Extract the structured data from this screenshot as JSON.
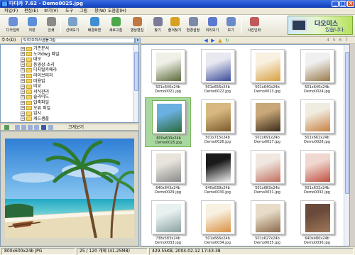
{
  "window": {
    "title": "다다카 7.62 - Demo0025.jpg"
  },
  "menu": [
    "파일(F)",
    "편집(E)",
    "보기(V)",
    "도구",
    "그림",
    "창(W)",
    "도움말(H)"
  ],
  "toolbar": [
    {
      "label": "디카입력",
      "icon": "camera-input-icon",
      "color": "#6a8fd6"
    },
    {
      "label": "저장",
      "icon": "save-icon",
      "color": "#5b8fd8"
    },
    {
      "label": "인쇄",
      "icon": "print-icon",
      "color": "#8a8a8a"
    },
    {
      "label": "선택보기",
      "icon": "select-view-icon",
      "color": "#7aa0c8"
    },
    {
      "label": "배경화면",
      "icon": "wallpaper-icon",
      "color": "#3f8fd0"
    },
    {
      "label": "새로고침",
      "icon": "refresh-icon",
      "color": "#4aa84a"
    },
    {
      "label": "영상편집",
      "icon": "image-edit-icon",
      "color": "#c07840"
    },
    {
      "label": "찾기",
      "icon": "find-icon",
      "color": "#7a7a9a"
    },
    {
      "label": "즐겨찾기",
      "icon": "favorites-icon",
      "color": "#d8a020"
    },
    {
      "label": "환경설정",
      "icon": "settings-icon",
      "color": "#7a8aa8"
    },
    {
      "label": "미리보기",
      "icon": "preview-icon",
      "color": "#5a7ad0"
    },
    {
      "label": "보기",
      "icon": "view-icon",
      "color": "#6a8ac8"
    },
    {
      "label": "사진인화",
      "icon": "photo-print-icon",
      "color": "#c05a5a"
    }
  ],
  "banner": {
    "line1": "다오미스",
    "line2": "있습니다."
  },
  "address": {
    "label": "주소(D)",
    "value": "S:\\다오미스\\샘플그림"
  },
  "page_numbers": "4 5 6 7",
  "folders": [
    {
      "name": "기존문서",
      "expanded": false
    },
    {
      "name": "노아dwg 파일",
      "expanded": false
    },
    {
      "name": "대오",
      "expanded": false
    },
    {
      "name": "동영상-소리",
      "expanded": false
    },
    {
      "name": "디지털카메라",
      "expanded": false
    },
    {
      "name": "라이브러리",
      "expanded": false
    },
    {
      "name": "미용업",
      "expanded": false
    },
    {
      "name": "비교",
      "expanded": false
    },
    {
      "name": "서식관리",
      "expanded": false
    },
    {
      "name": "솔라이드",
      "expanded": false
    },
    {
      "name": "압축파일",
      "expanded": false
    },
    {
      "name": "오류 파일",
      "expanded": false
    },
    {
      "name": "임시",
      "expanded": false
    },
    {
      "name": "캐드샘플",
      "expanded": false
    }
  ],
  "preview": {
    "title": "크게보기"
  },
  "thumbnails": [
    {
      "size": "501x640x24b",
      "name": "Demo0021.jpg",
      "selected": false,
      "colors": [
        "#f0f0e8",
        "#5a6a3a"
      ]
    },
    {
      "size": "501x656x24b",
      "name": "Demo0022.jpg",
      "selected": false,
      "colors": [
        "#e8e8f0",
        "#3a4a9a"
      ]
    },
    {
      "size": "501x640x24b",
      "name": "Demo0023.jpg",
      "selected": false,
      "colors": [
        "#f8f0e0",
        "#d8a040"
      ]
    },
    {
      "size": "501x640x24b",
      "name": "Demo0024.jpg",
      "selected": false,
      "colors": [
        "#f0f0f0",
        "#9a7a4a"
      ]
    },
    {
      "size": "800x600x24b",
      "name": "Demo0025.jpg",
      "selected": true,
      "colors": [
        "#6ab0e0",
        "#2a6a3a"
      ]
    },
    {
      "size": "501x715x24b",
      "name": "Demo0026.jpg",
      "selected": false,
      "colors": [
        "#d8b880",
        "#7a5a2a"
      ]
    },
    {
      "size": "501x691x24b",
      "name": "Demo0027.jpg",
      "selected": false,
      "colors": [
        "#c8a878",
        "#3a2a1a"
      ]
    },
    {
      "size": "501x662x24b",
      "name": "Demo0028.jpg",
      "selected": false,
      "colors": [
        "#f0ece0",
        "#c88040"
      ]
    },
    {
      "size": "640x643x24b",
      "name": "Demo0029.jpg",
      "selected": false,
      "colors": [
        "#e8e4dc",
        "#8a8a8a"
      ]
    },
    {
      "size": "640x639x24b",
      "name": "Demo0030.jpg",
      "selected": false,
      "colors": [
        "#1a1a1a",
        "#f0f0f0"
      ]
    },
    {
      "size": "501x683x24b",
      "name": "Demo0031.jpg",
      "selected": false,
      "colors": [
        "#f0e8e0",
        "#c07060"
      ]
    },
    {
      "size": "501x632x24b",
      "name": "Demo0032.jpg",
      "selected": false,
      "colors": [
        "#f0d8d0",
        "#c05040"
      ]
    },
    {
      "size": "738x583x24b",
      "name": "Demo0033.jpg",
      "selected": false,
      "colors": [
        "#e8f0f0",
        "#8aa0a0"
      ]
    },
    {
      "size": "501x666x24b",
      "name": "Demo0034.jpg",
      "selected": false,
      "colors": [
        "#f8f0e0",
        "#d89040"
      ]
    },
    {
      "size": "501x627x24b",
      "name": "Demo0035.jpg",
      "selected": false,
      "colors": [
        "#e8dcc8",
        "#8a6a4a"
      ]
    },
    {
      "size": "640x480x24b",
      "name": "Demo0036.jpg",
      "selected": false,
      "colors": [
        "#6a4a3a",
        "#a07858"
      ]
    }
  ],
  "status": {
    "image_info": "800x600x24b JPG",
    "count": "25 / 120 개체 (41.25MB)",
    "file_info": "429.55KB, 2004-02-12 17:43:38"
  }
}
